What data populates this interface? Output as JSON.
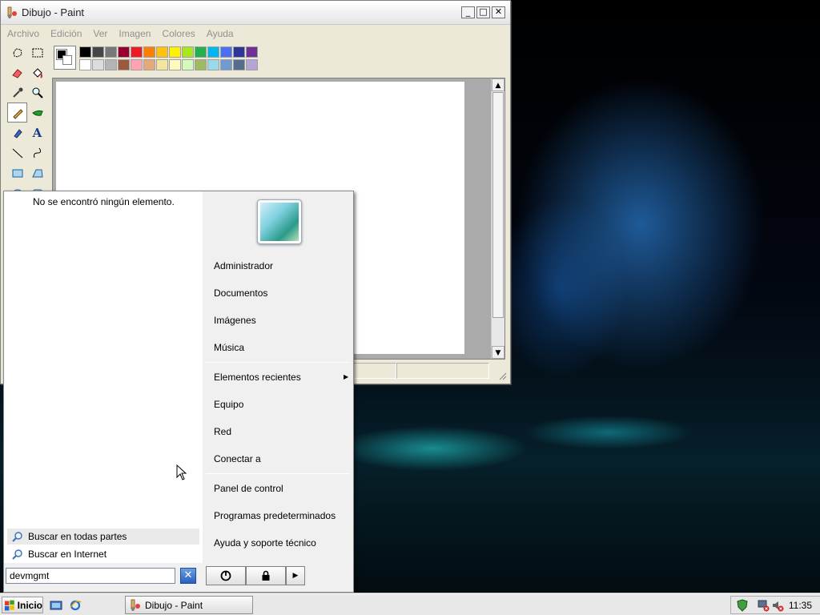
{
  "paint": {
    "title": "Dibujo - Paint",
    "menu": [
      "Archivo",
      "Edición",
      "Ver",
      "Imagen",
      "Colores",
      "Ayuda"
    ],
    "controls": {
      "minimize": "_",
      "maximize": "□",
      "close": "✕"
    },
    "tools": [
      "free-select-icon",
      "rect-select-icon",
      "eraser-icon",
      "fill-icon",
      "color-picker-icon",
      "magnifier-icon",
      "pencil-icon",
      "brush-icon",
      "airbrush-icon",
      "text-icon",
      "line-icon",
      "curve-icon",
      "rectangle-icon",
      "polygon-icon",
      "ellipse-icon",
      "rounded-rect-icon"
    ],
    "text_tool_glyph": "A",
    "palette_row1": [
      "#000000",
      "#464646",
      "#787878",
      "#990030",
      "#ed1c24",
      "#ff7e00",
      "#ffc20e",
      "#fff200",
      "#a8e61d",
      "#22b14c",
      "#00b7ef",
      "#4d6df3",
      "#2f3699",
      "#6f3198"
    ],
    "palette_row2": [
      "#ffffff",
      "#dcdcdc",
      "#b4b4b4",
      "#9c5a3c",
      "#ffa3b1",
      "#e5aa7a",
      "#f5e49c",
      "#fff9bd",
      "#d3f9bc",
      "#9dbb61",
      "#99d9ea",
      "#709ad1",
      "#546d8e",
      "#b5a5d5"
    ]
  },
  "start_menu": {
    "no_results": "No se encontró ningún elemento.",
    "search_everywhere": "Buscar en todas partes",
    "search_internet": "Buscar en Internet",
    "search_value": "devmgmt",
    "right_items_group1": [
      "Administrador",
      "Documentos",
      "Imágenes",
      "Música"
    ],
    "right_items_group2": [
      "Elementos recientes",
      "Equipo",
      "Red",
      "Conectar a"
    ],
    "right_items_group3": [
      "Panel de control",
      "Programas predeterminados",
      "Ayuda y soporte técnico"
    ],
    "clear_glyph": "✕",
    "arrow_glyph": "▶"
  },
  "taskbar": {
    "start_label": "Inicio",
    "task_label": "Dibujo - Paint",
    "clock": "11:35"
  }
}
